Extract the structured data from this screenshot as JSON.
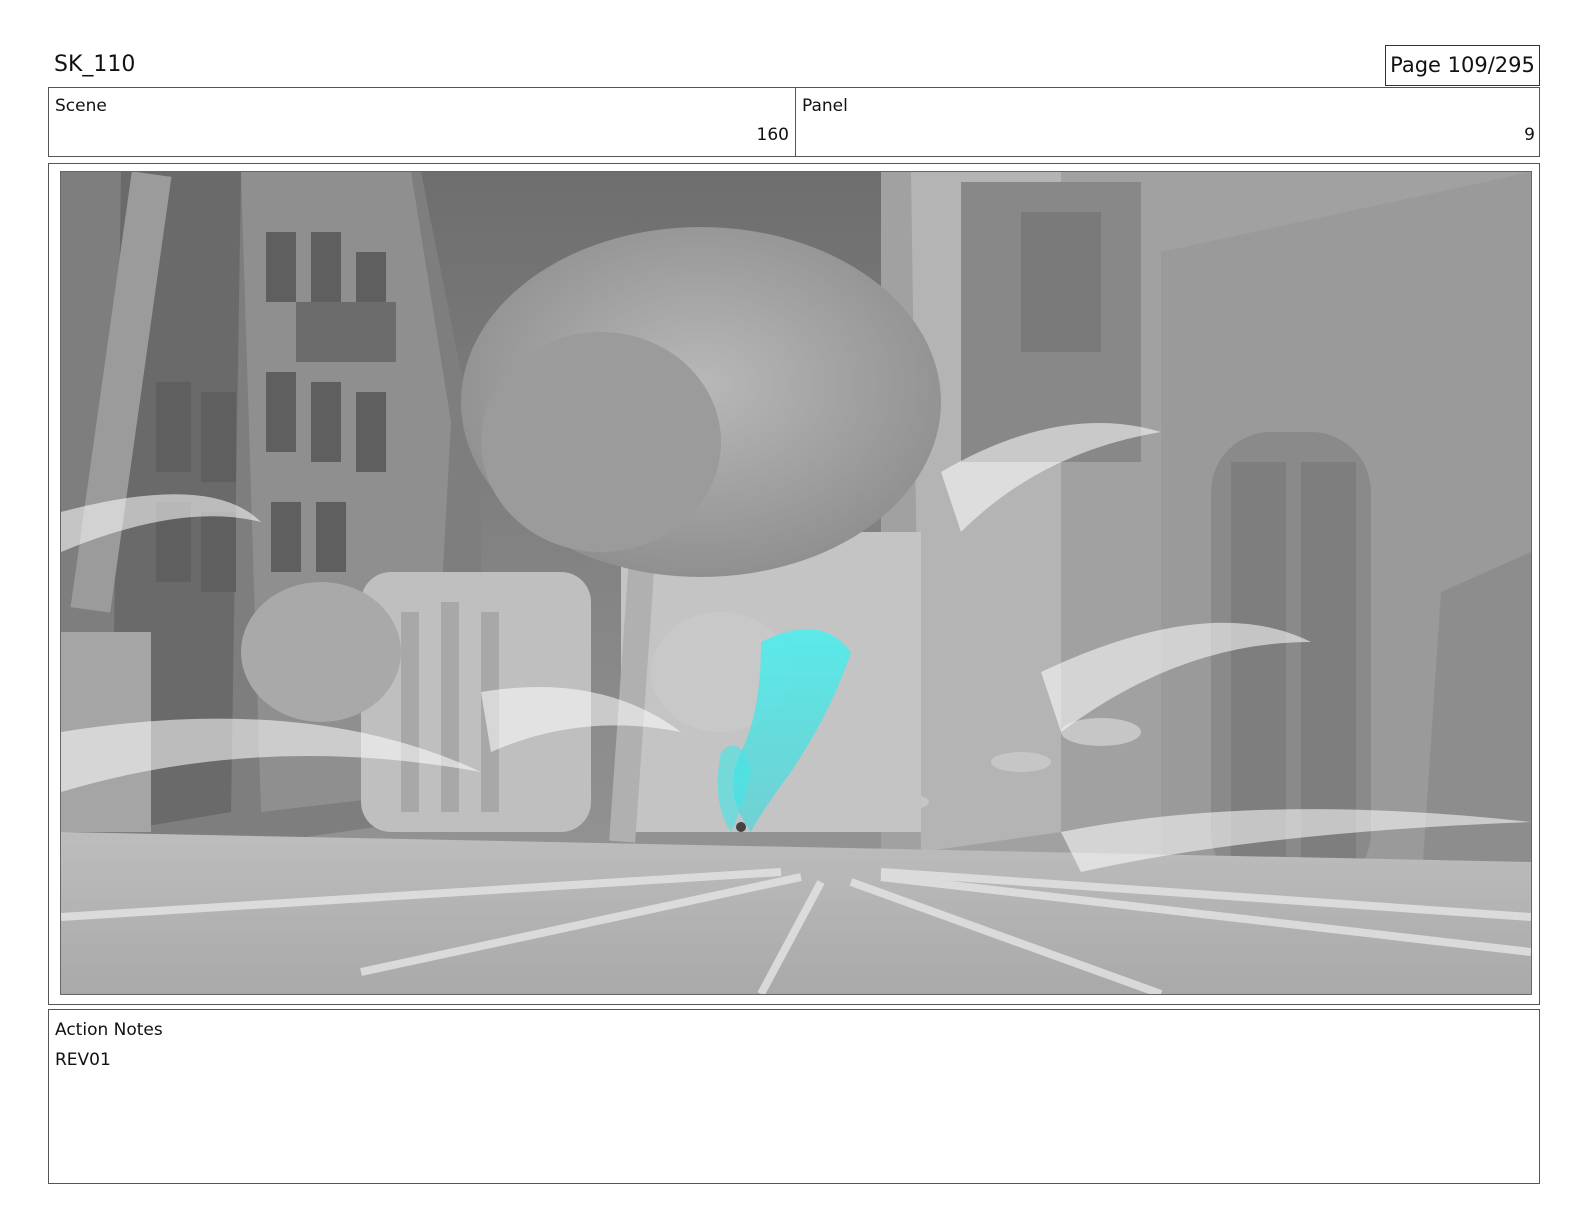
{
  "header": {
    "title": "SK_110",
    "page": "Page 109/295"
  },
  "info": {
    "scene_label": "Scene",
    "scene_value": "160",
    "panel_label": "Panel",
    "panel_value": "9"
  },
  "frame": {
    "image_description_icon": "storyboard-render",
    "accent_color": "#3fe8ea"
  },
  "notes": {
    "label": "Action Notes",
    "text": "REV01"
  }
}
